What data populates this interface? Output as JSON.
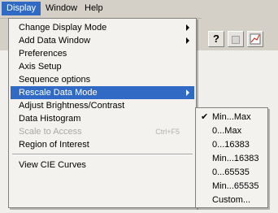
{
  "menubar": {
    "items": [
      {
        "label": "Display",
        "active": true
      },
      {
        "label": "Window",
        "active": false
      },
      {
        "label": "Help",
        "active": false
      }
    ]
  },
  "toolbar": {
    "buttons": [
      {
        "icon": "question-mark-icon",
        "glyph": "?"
      },
      {
        "icon": "gray-square-icon",
        "glyph": ""
      },
      {
        "icon": "chart-icon",
        "glyph": ""
      }
    ]
  },
  "display_menu": {
    "items": [
      {
        "label": "Change Display Mode",
        "submenu": true
      },
      {
        "label": "Add Data Window",
        "submenu": true
      },
      {
        "label": "Preferences"
      },
      {
        "label": "Axis Setup"
      },
      {
        "label": "Sequence options"
      },
      {
        "label": "Rescale Data Mode",
        "submenu": true,
        "highlighted": true
      },
      {
        "label": "Adjust Brightness/Contrast"
      },
      {
        "label": "Data Histogram"
      },
      {
        "label": "Scale to Access",
        "shortcut": "Ctrl+F5",
        "disabled": true
      },
      {
        "label": "Region of Interest"
      },
      {
        "label": "View CIE Curves"
      }
    ]
  },
  "rescale_submenu": {
    "items": [
      {
        "label": "Min...Max",
        "checked": true
      },
      {
        "label": "0...Max"
      },
      {
        "label": "0...16383"
      },
      {
        "label": "Min...16383"
      },
      {
        "label": "0...65535"
      },
      {
        "label": "Min...65535"
      },
      {
        "label": "Custom..."
      }
    ],
    "check_glyph": "✔"
  }
}
